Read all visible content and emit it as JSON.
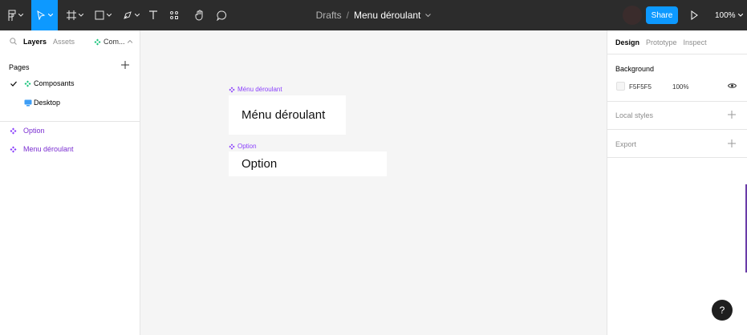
{
  "toolbar": {
    "breadcrumb": "Drafts",
    "separator": "/",
    "file_name": "Menu déroulant",
    "share_label": "Share",
    "zoom": "100%"
  },
  "left_panel": {
    "tabs": {
      "layers": "Layers",
      "assets": "Assets",
      "page": "Com..."
    },
    "pages_header": "Pages",
    "pages": [
      {
        "label": "Composants",
        "current": true
      },
      {
        "label": "Desktop",
        "current": false
      }
    ],
    "layers": [
      {
        "label": "Option"
      },
      {
        "label": "Menu déroulant"
      }
    ]
  },
  "canvas": {
    "frames": [
      {
        "label": "Ménu déroulant",
        "text": "Ménu déroulant"
      },
      {
        "label": "Option",
        "text": "Option"
      }
    ]
  },
  "right_panel": {
    "tabs": {
      "design": "Design",
      "prototype": "Prototype",
      "inspect": "Inspect"
    },
    "background_header": "Background",
    "background_hex": "F5F5F5",
    "background_opacity": "100%",
    "local_styles": "Local styles",
    "export": "Export"
  },
  "help_label": "?",
  "colors": {
    "accent": "#0d99ff",
    "component": "#8a3ffc",
    "toolbar": "#2c2c2c",
    "canvas": "#f5f5f5"
  }
}
